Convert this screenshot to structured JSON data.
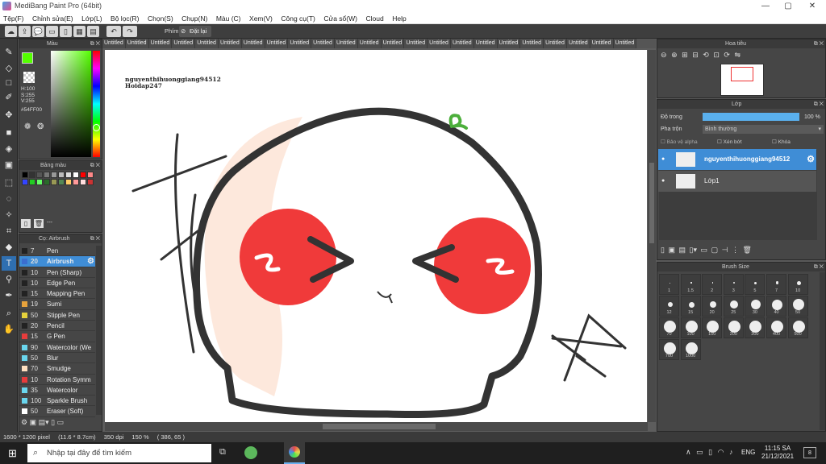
{
  "window": {
    "title": "MediBang Paint Pro (64bit)",
    "min": "—",
    "max": "▢",
    "close": "✕"
  },
  "menu": [
    "Tệp(F)",
    "Chỉnh sửa(E)",
    "Lớp(L)",
    "Bộ lọc(R)",
    "Chọn(S)",
    "Chụp(N)",
    "Màu (C)",
    "Xem(V)",
    "Công cụ(T)",
    "Cửa sổ(W)",
    "Cloud",
    "Help"
  ],
  "toolbar": {
    "phim_label": "Phím",
    "reset_label": "Đặt lại"
  },
  "tabs": [
    "Untitled",
    "Untitled",
    "Untitled",
    "Untitled",
    "Untitled",
    "Untitled",
    "Untitled",
    "Untitled",
    "Untitled",
    "Untitled",
    "Untitled",
    "Untitled",
    "Untitled",
    "Untitled",
    "Untitled",
    "Untitled",
    "Untitled",
    "Untitled",
    "Untitled",
    "Untitled",
    "Untitled",
    "Untitled",
    "Untitled"
  ],
  "color_panel": {
    "title": "Màu",
    "h": "H:100",
    "s": "S:255",
    "v": "V:255",
    "hex": "#54FF00",
    "fg": "#54ff00"
  },
  "palette_panel": {
    "title": "Bảng màu",
    "dash": "---",
    "colors": [
      "#000000",
      "#333333",
      "#555555",
      "#777777",
      "#999999",
      "#bbbbbb",
      "#dddddd",
      "#ffffff",
      "#ff0000",
      "#ff8888",
      "#3344ff",
      "#22cc22",
      "#66ff66",
      "#2a6a2a",
      "#999955",
      "#558855",
      "#ffcc66",
      "#ff9999",
      "#ffdddd",
      "#cc3333"
    ]
  },
  "brush_panel": {
    "title": "Cọ: Airbrush",
    "brushes": [
      {
        "size": "7",
        "name": "Pen",
        "color": "#222222"
      },
      {
        "size": "20",
        "name": "Airbrush",
        "color": "#3b6ed0"
      },
      {
        "size": "10",
        "name": "Pen (Sharp)",
        "color": "#222222"
      },
      {
        "size": "10",
        "name": "Edge Pen",
        "color": "#222222"
      },
      {
        "size": "15",
        "name": "Mapping Pen",
        "color": "#222222"
      },
      {
        "size": "19",
        "name": "Sumi",
        "color": "#e6a23c"
      },
      {
        "size": "50",
        "name": "Stipple Pen",
        "color": "#e6d23c"
      },
      {
        "size": "20",
        "name": "Pencil",
        "color": "#222222"
      },
      {
        "size": "15",
        "name": "G Pen",
        "color": "#e63c3c"
      },
      {
        "size": "90",
        "name": "Watercolor (We",
        "color": "#6ad6ee"
      },
      {
        "size": "50",
        "name": "Blur",
        "color": "#6ad6ee"
      },
      {
        "size": "70",
        "name": "Smudge",
        "color": "#ffe0c0"
      },
      {
        "size": "10",
        "name": "Rotation Symm",
        "color": "#e63c3c"
      },
      {
        "size": "35",
        "name": "Watercolor",
        "color": "#6ad6ee"
      },
      {
        "size": "100",
        "name": "Sparkle Brush",
        "color": "#6ad6ee"
      },
      {
        "size": "50",
        "name": "Eraser (Soft)",
        "color": "#ffffff"
      }
    ]
  },
  "canvas": {
    "watermark_line1": "nguyenthihuonggiang94512",
    "watermark_line2": "Hoidap247"
  },
  "navigator": {
    "title": "Hoa tiêu"
  },
  "layer_panel": {
    "title": "Lớp",
    "opacity_label": "Độ trong",
    "opacity_value": "100 %",
    "blend_label": "Pha trộn",
    "blend_value": "Bình thường",
    "alpha_label": "Bảo vệ alpha",
    "clip_label": "Xén bớt",
    "lock_label": "Khóa",
    "layers": [
      {
        "name": "nguyenthihuonggiang94512"
      },
      {
        "name": "Lớp1"
      }
    ]
  },
  "brush_size": {
    "title": "Brush Size",
    "sizes": [
      "1",
      "1.5",
      "2",
      "3",
      "5",
      "7",
      "10",
      "12",
      "15",
      "20",
      "25",
      "30",
      "40",
      "50",
      "70",
      "100",
      "150",
      "200",
      "300",
      "400",
      "500",
      "700",
      "1000"
    ]
  },
  "status": {
    "dims": "1600 * 1200 pixel",
    "cm": "(11.6 * 8.7cm)",
    "dpi": "350 dpi",
    "zoom": "150 %",
    "coords": "( 386, 65 )"
  },
  "taskbar": {
    "search_placeholder": "Nhập tại đây để tìm kiếm",
    "lang": "ENG",
    "time": "11:15 SA",
    "date": "21/12/2021",
    "notif_count": "8"
  }
}
